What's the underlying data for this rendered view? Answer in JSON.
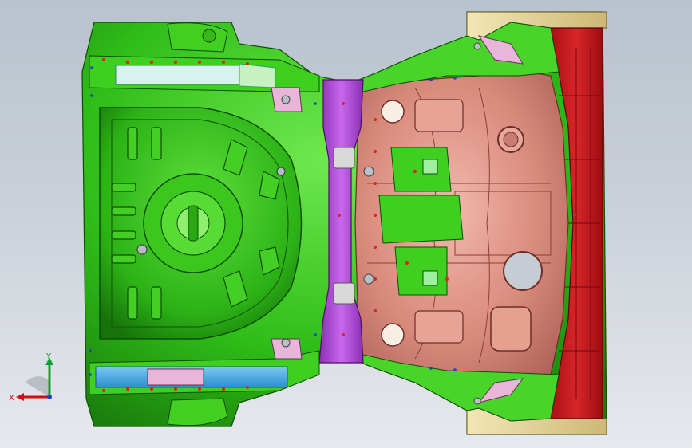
{
  "viewport": {
    "background_top": "#b9c2cd",
    "background_bottom": "#e6e9ed"
  },
  "colors": {
    "floor_green": "#36c81a",
    "floor_dark": "#1e8a0e",
    "crossmember_purple": "#b04ad6",
    "panel_salmon": "#d98d80",
    "rail_red": "#c8191e",
    "rail_blue": "#34a7e6",
    "bracket_tan": "#e7d79b",
    "bracket_pink": "#e8b6d8"
  },
  "triad": {
    "x_label": "X",
    "y_label": "Y",
    "x_color": "#d01010",
    "y_color": "#10a030",
    "z_color": "#2040d0"
  }
}
